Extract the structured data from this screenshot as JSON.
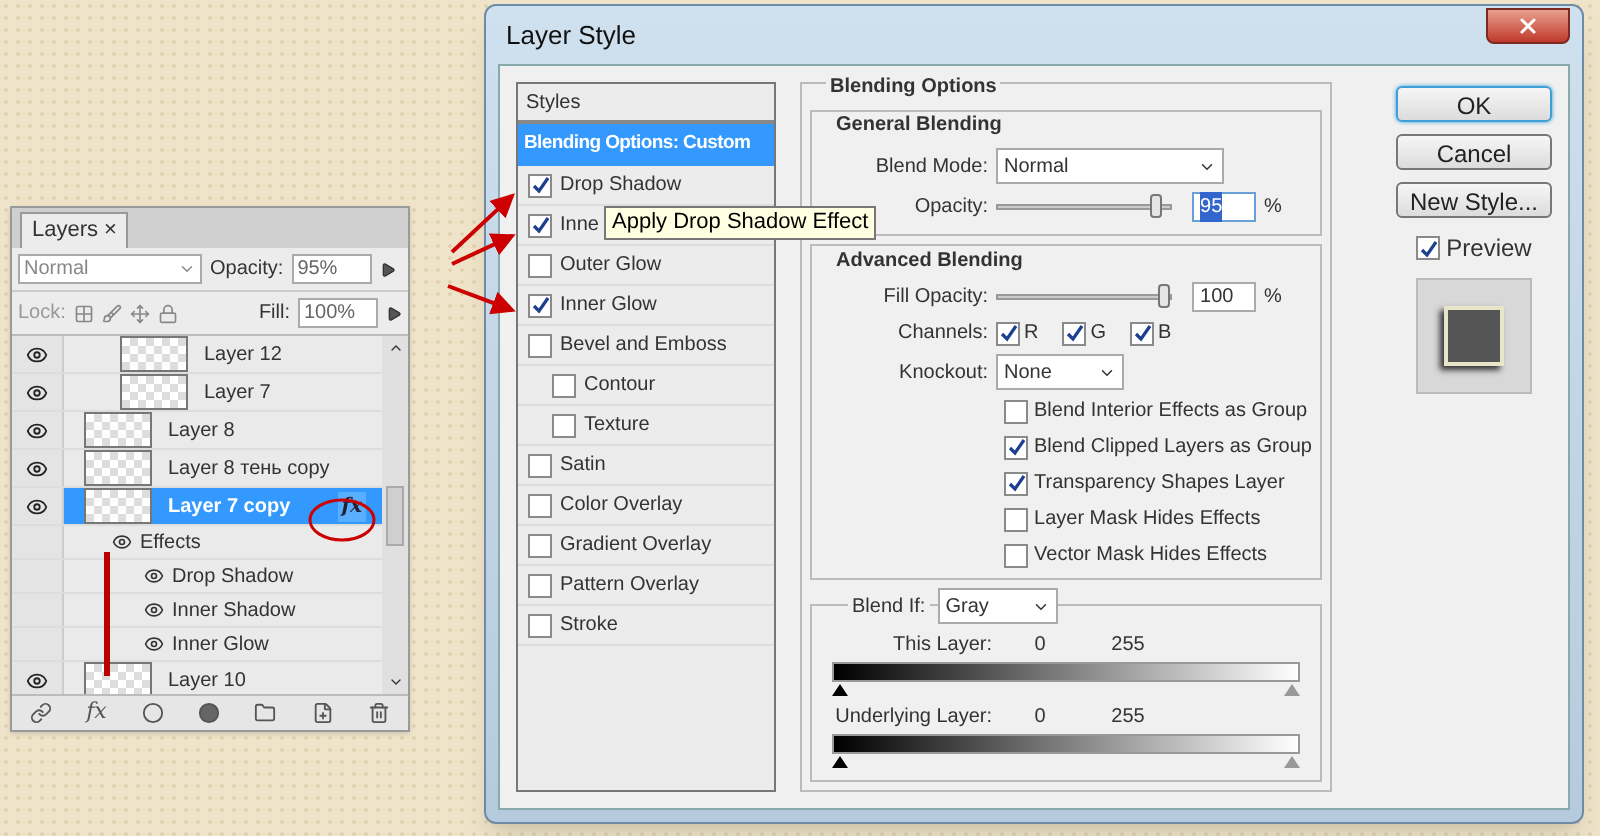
{
  "layers_panel": {
    "tab": "Layers",
    "tab_close": "×",
    "mode": "Normal",
    "opacity_label": "Opacity:",
    "opacity": "95%",
    "lock_label": "Lock:",
    "fill_label": "Fill:",
    "fill": "100%",
    "layers": [
      {
        "name": "Layer 12",
        "kind": "grouped",
        "visible": true,
        "selected": false
      },
      {
        "name": "Layer 7",
        "kind": "grouped",
        "visible": true,
        "selected": false
      },
      {
        "name": "Layer 8",
        "kind": "layer",
        "visible": true,
        "selected": false
      },
      {
        "name": "Layer 8 тень copy",
        "kind": "layer",
        "visible": true,
        "selected": false
      },
      {
        "name": "Layer 7 copy",
        "kind": "layer",
        "visible": true,
        "selected": true,
        "fx": "fx",
        "effects_label": "Effects",
        "children": [
          {
            "name": "Drop Shadow",
            "visible": true
          },
          {
            "name": "Inner Shadow",
            "visible": true
          },
          {
            "name": "Inner Glow",
            "visible": true
          }
        ]
      },
      {
        "name": "Layer 10",
        "kind": "layer",
        "visible": true,
        "selected": false
      }
    ],
    "footer_fx": "fx"
  },
  "dialog": {
    "title": "Layer Style",
    "styles_header": "Styles",
    "styles": [
      {
        "label": "Blending Options: Custom",
        "kind": "header",
        "selected": true
      },
      {
        "label": "Drop Shadow",
        "kind": "check",
        "checked": true,
        "selected": false
      },
      {
        "label": "Inne",
        "kind": "check",
        "checked": true,
        "selected": false
      },
      {
        "label": "Outer Glow",
        "kind": "check",
        "checked": false,
        "selected": false
      },
      {
        "label": "Inner Glow",
        "kind": "check",
        "checked": true,
        "selected": false
      },
      {
        "label": "Bevel and Emboss",
        "kind": "check",
        "checked": false,
        "selected": false,
        "children": [
          {
            "label": "Contour",
            "checked": false
          },
          {
            "label": "Texture",
            "checked": false
          }
        ]
      },
      {
        "label": "Satin",
        "kind": "check",
        "checked": false,
        "selected": false
      },
      {
        "label": "Color Overlay",
        "kind": "check",
        "checked": false,
        "selected": false
      },
      {
        "label": "Gradient Overlay",
        "kind": "check",
        "checked": false,
        "selected": false
      },
      {
        "label": "Pattern Overlay",
        "kind": "check",
        "checked": false,
        "selected": false
      },
      {
        "label": "Stroke",
        "kind": "check",
        "checked": false,
        "selected": false
      }
    ],
    "tooltip": "Apply Drop Shadow Effect",
    "blending": {
      "title": "Blending Options",
      "general": {
        "title": "General Blending",
        "blend_mode_label": "Blend Mode:",
        "blend_mode": "Normal",
        "opacity_label": "Opacity:",
        "opacity_slider": {
          "level": 0.95
        },
        "opacity": "95",
        "unit": "%"
      },
      "advanced": {
        "title": "Advanced Blending",
        "fill_label": "Fill Opacity:",
        "fill_slider": {
          "level": 1
        },
        "fill": "100",
        "unit": "%",
        "channels_label": "Channels:",
        "channels": [
          {
            "label": "R",
            "checked": true
          },
          {
            "label": "G",
            "checked": true
          },
          {
            "label": "B",
            "checked": true
          }
        ],
        "knockout_label": "Knockout:",
        "knockout": "None",
        "options": [
          {
            "label": "Blend Interior Effects as Group",
            "checked": false
          },
          {
            "label": "Blend Clipped Layers as Group",
            "checked": true
          },
          {
            "label": "Transparency Shapes Layer",
            "checked": true
          },
          {
            "label": "Layer Mask Hides Effects",
            "checked": false
          },
          {
            "label": "Vector Mask Hides Effects",
            "checked": false
          }
        ]
      },
      "blend_if": {
        "label": "Blend If:",
        "value": "Gray",
        "ranges": [
          {
            "label": "This Layer:",
            "low": "0",
            "high": "255"
          },
          {
            "label": "Underlying Layer:",
            "low": "0",
            "high": "255"
          }
        ]
      }
    },
    "buttons": [
      {
        "label": "OK",
        "default": true
      },
      {
        "label": "Cancel",
        "default": false
      },
      {
        "label": "New Style...",
        "default": false
      }
    ],
    "preview": {
      "label": "Preview",
      "checked": true
    }
  }
}
